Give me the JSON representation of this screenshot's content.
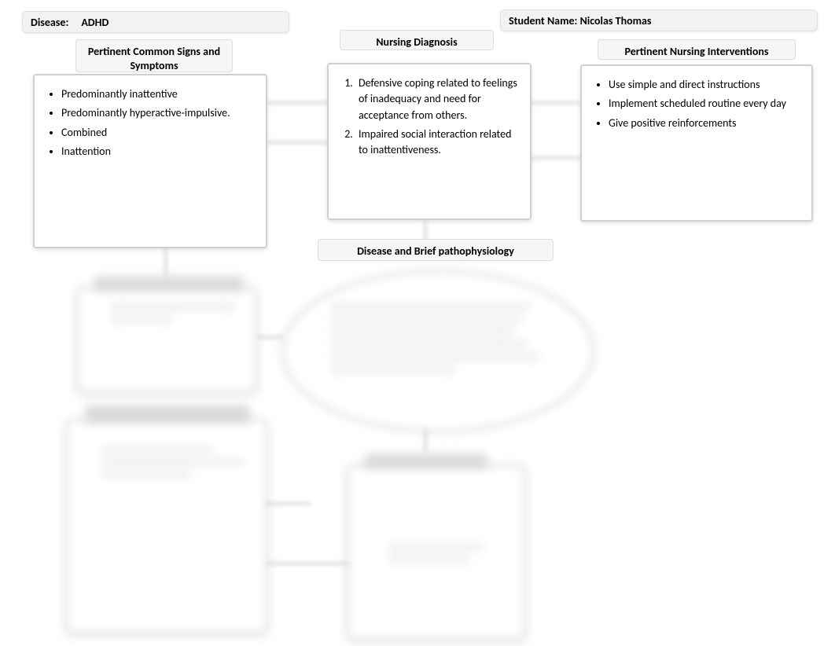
{
  "header": {
    "disease_label": "Disease:",
    "disease_value": "ADHD",
    "student_label": "Student Name:",
    "student_value": "Nicolas Thomas"
  },
  "signs": {
    "title": "Pertinent Common Signs and Symptoms",
    "items": [
      "Predominantly inattentive",
      "Predominantly hyperactive-impulsive.",
      "Combined",
      "Inattention"
    ]
  },
  "diagnosis": {
    "title": "Nursing Diagnosis",
    "items": [
      "Defensive coping related to feelings of inadequacy and need for acceptance from others.",
      "Impaired social interaction related to inattentiveness."
    ]
  },
  "interventions": {
    "title": "Pertinent Nursing Interventions",
    "items": [
      "Use simple and direct instructions",
      "Implement scheduled routine every day",
      "Give positive reinforcements"
    ]
  },
  "patho": {
    "title": "Disease and Brief pathophysiology"
  }
}
